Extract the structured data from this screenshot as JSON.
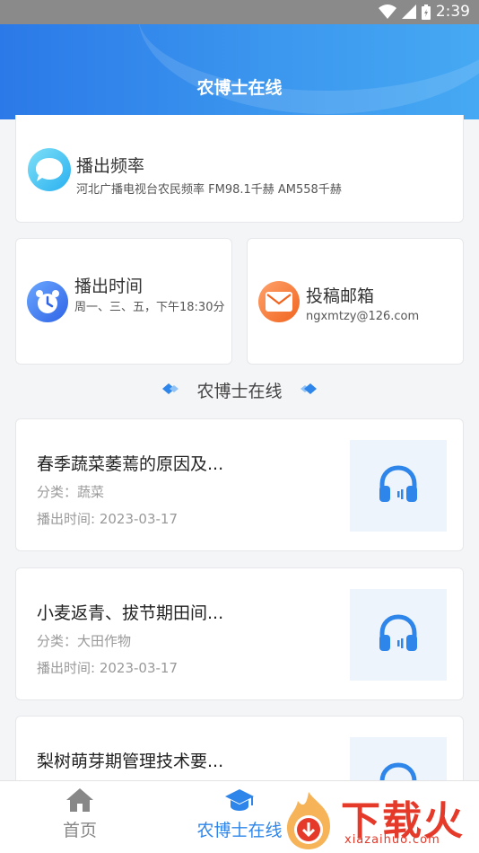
{
  "status_bar": {
    "time": "2:39"
  },
  "header": {
    "title": "农博士在线"
  },
  "broadcast_frequency": {
    "title": "播出频率",
    "detail": "河北广播电视台农民频率   FM98.1千赫   AM558千赫"
  },
  "broadcast_time": {
    "title": "播出时间",
    "detail": "周一、三、五，下午18:30分"
  },
  "submission_email": {
    "title": "投稿邮箱",
    "email": "ngxmtzy@126.com"
  },
  "section": {
    "title": "农博士在线"
  },
  "items": [
    {
      "title": "春季蔬菜萎蔫的原因及...",
      "category": "分类：蔬菜",
      "date": "播出时间: 2023-03-17"
    },
    {
      "title": "小麦返青、拔节期田间...",
      "category": "分类：大田作物",
      "date": "播出时间: 2023-03-17"
    },
    {
      "title": "梨树萌芽期管理技术要..."
    }
  ],
  "tabs": [
    {
      "label": "首页",
      "icon": "home-icon",
      "active": false
    },
    {
      "label": "农博士在线",
      "icon": "graduation-cap-icon",
      "active": true
    }
  ],
  "watermark": {
    "text": "下载火",
    "url": "xiazaihuo.com"
  },
  "colors": {
    "primary": "#2f86ea",
    "tab_inactive": "#888888",
    "watermark": "#e53a2a"
  }
}
